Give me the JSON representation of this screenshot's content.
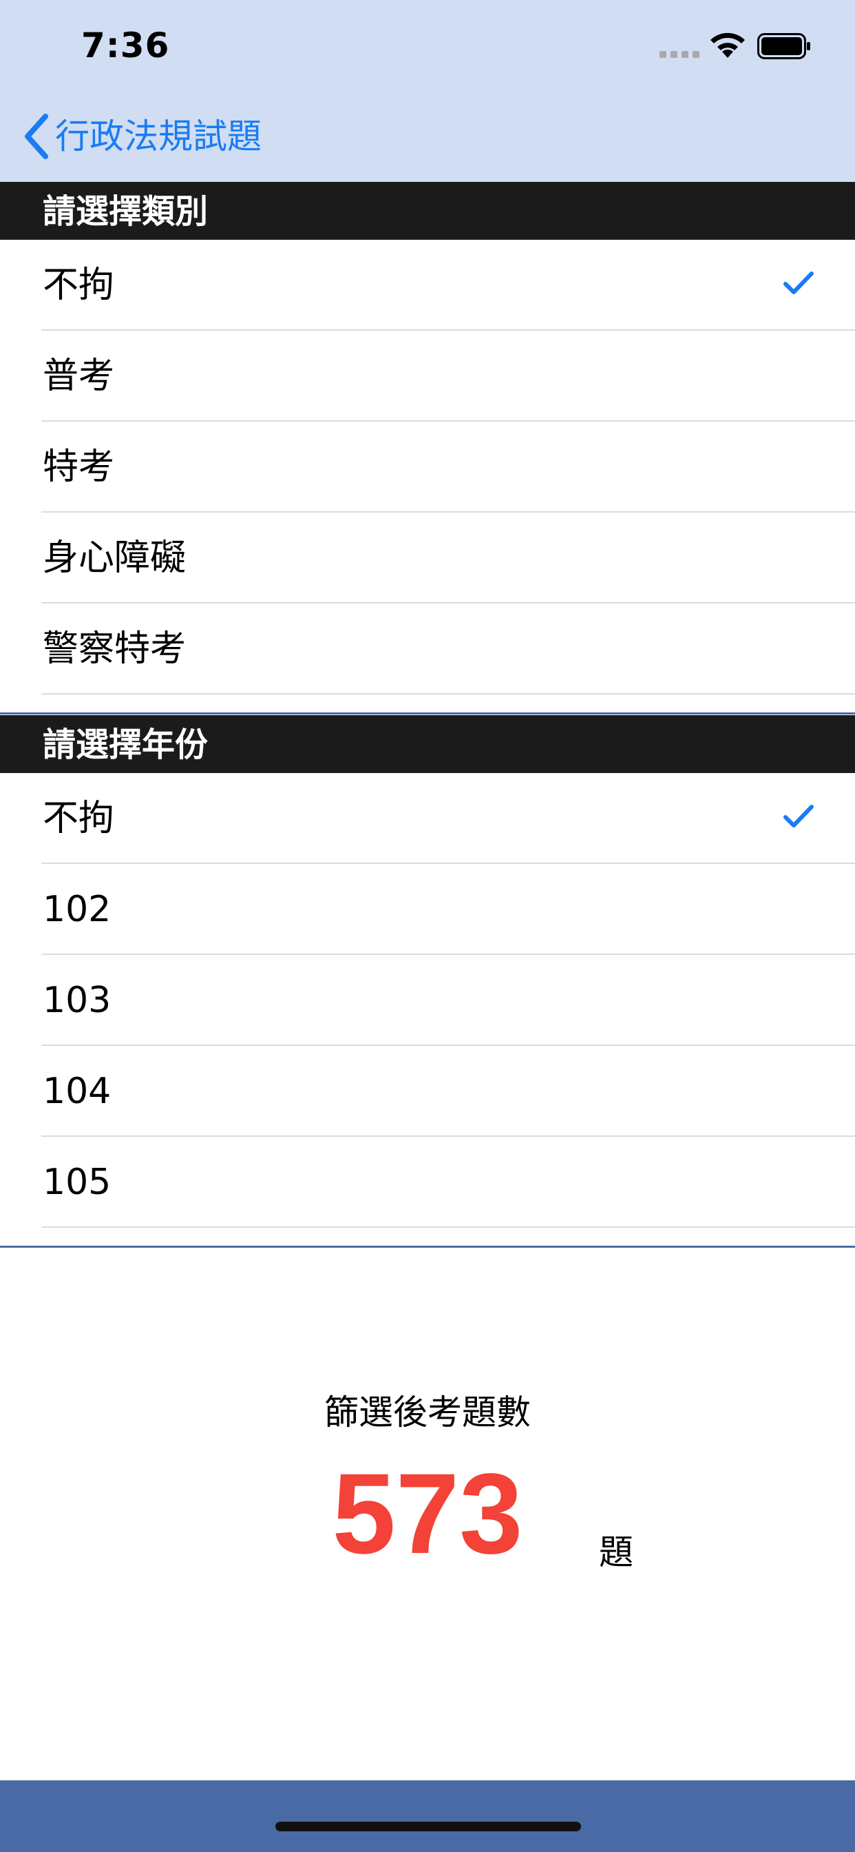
{
  "status_bar": {
    "time": "7:36"
  },
  "nav": {
    "back_label": "行政法規試題"
  },
  "category_section": {
    "header": "請選擇類別",
    "items": [
      {
        "label": "不拘",
        "selected": true
      },
      {
        "label": "普考",
        "selected": false
      },
      {
        "label": "特考",
        "selected": false
      },
      {
        "label": "身心障礙",
        "selected": false
      },
      {
        "label": "警察特考",
        "selected": false
      }
    ]
  },
  "year_section": {
    "header": "請選擇年份",
    "items": [
      {
        "label": "不拘",
        "selected": true
      },
      {
        "label": "102",
        "selected": false
      },
      {
        "label": "103",
        "selected": false
      },
      {
        "label": "104",
        "selected": false
      },
      {
        "label": "105",
        "selected": false
      }
    ]
  },
  "result": {
    "title": "篩選後考題數",
    "count": "573",
    "unit": "題"
  },
  "colors": {
    "accent": "#1a7cf2",
    "count": "#f34237",
    "nav_bg": "#d0ddf2",
    "header_bg": "#1b1b1b",
    "bottom_bar": "#4a6aa6"
  }
}
